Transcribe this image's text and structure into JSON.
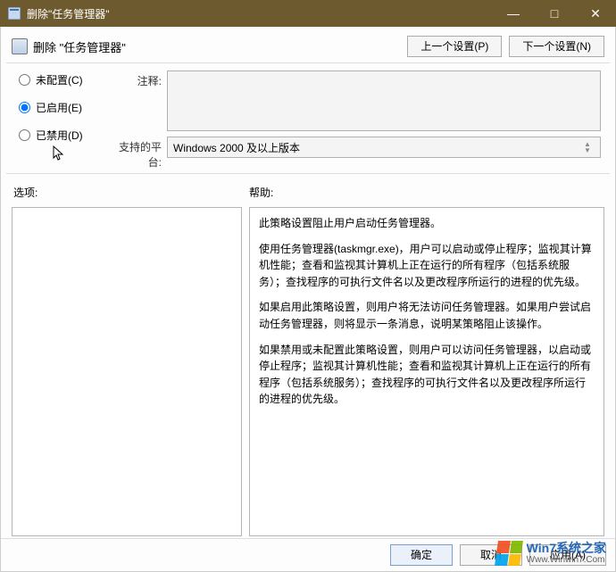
{
  "title": "删除\"任务管理器\"",
  "header": {
    "text": "删除 \"任务管理器\"",
    "prev_button": "上一个设置(P)",
    "next_button": "下一个设置(N)"
  },
  "radios": {
    "not_configured": "未配置(C)",
    "enabled": "已启用(E)",
    "disabled": "已禁用(D)"
  },
  "labels": {
    "comment": "注释:",
    "platform": "支持的平台:",
    "options": "选项:",
    "help": "帮助:"
  },
  "fields": {
    "comment_value": "",
    "platform_value": "Windows 2000 及以上版本"
  },
  "help_text": {
    "p1": "此策略设置阻止用户启动任务管理器。",
    "p2": "使用任务管理器(taskmgr.exe)，用户可以启动或停止程序；监视其计算机性能；查看和监视其计算机上正在运行的所有程序（包括系统服务）；查找程序的可执行文件名以及更改程序所运行的进程的优先级。",
    "p3": "如果启用此策略设置，则用户将无法访问任务管理器。如果用户尝试启动任务管理器，则将显示一条消息，说明某策略阻止该操作。",
    "p4": "如果禁用或未配置此策略设置，则用户可以访问任务管理器，以启动或停止程序；监视其计算机性能；查看和监视其计算机上正在运行的所有程序（包括系统服务）；查找程序的可执行文件名以及更改程序所运行的进程的优先级。"
  },
  "buttons": {
    "ok": "确定",
    "cancel": "取消",
    "apply": "应用(A)"
  },
  "watermark": {
    "cn": "Win7系统之家",
    "url": "Www.Winwin7.Com"
  },
  "window_controls": {
    "minimize": "—",
    "maximize": "□",
    "close": "✕"
  }
}
